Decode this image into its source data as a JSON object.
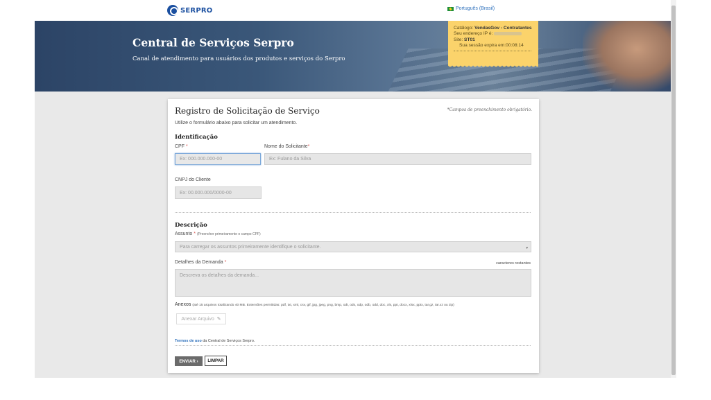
{
  "header": {
    "logo_text": "SERPRO",
    "language": "Português (Brasil)"
  },
  "hero": {
    "title": "Central de Serviços Serpro",
    "subtitle": "Canal de atendimento para usuários dos produtos e serviços do Serpro"
  },
  "session_info": {
    "catalog_label": "Catálogo:",
    "catalog_value": "VendasGov - Contratantes",
    "ip_label": "Seu endereço IP é:",
    "site_label": "Site:",
    "site_value": "ST01",
    "session_label": "Sua sessão expira em:",
    "session_value": "00:08:14"
  },
  "form": {
    "title": "Registro de Solicitação de Serviço",
    "required_note": "*Campos de preenchimento obrigatório.",
    "intro": "Utilize o formulário abaixo para solicitar um atendimento.",
    "identification": {
      "title": "Identificação",
      "cpf_label": "CPF",
      "cpf_placeholder": "Ex: 000.000.000-00",
      "name_label": "Nome do Solicitante",
      "name_placeholder": "Ex: Fulano da Silva",
      "cnpj_label": "CNPJ do Cliente",
      "cnpj_placeholder": "Ex: 00.000.000/0000-00"
    },
    "description": {
      "title": "Descrição",
      "subject_label": "Assunto",
      "subject_hint": "(Preencher primeiramente o campo CPF)",
      "subject_placeholder": "Para carregar os assuntos primeiramente identifique o solicitante.",
      "details_label": "Detalhes da Demanda",
      "chars_remaining": "caracteres restantes",
      "details_placeholder": "Descreva os detalhes da demanda..."
    },
    "attachments": {
      "label": "Anexos",
      "hint": "(até 15 arquivos totalizando 40 MB. Extensões permitidas: pdf, txt, xml, csv, gif, jpg, jpeg, png, bmp, odt, ods, odp, odb, odd, doc, xls, ppt, docx, xlsx, pptx, tar.gz, tar.xz ou zip)",
      "button": "Anexar Arquivo"
    },
    "terms": {
      "link": "Termos de uso",
      "text": " da Central de Serviços Serpro."
    },
    "buttons": {
      "send": "ENVIAR ›",
      "clear": "LIMPAR"
    }
  },
  "colors": {
    "brand": "#1a4fa0",
    "ticket": "#fbd36b",
    "required": "#d9534f",
    "link": "#2c6fbb"
  }
}
